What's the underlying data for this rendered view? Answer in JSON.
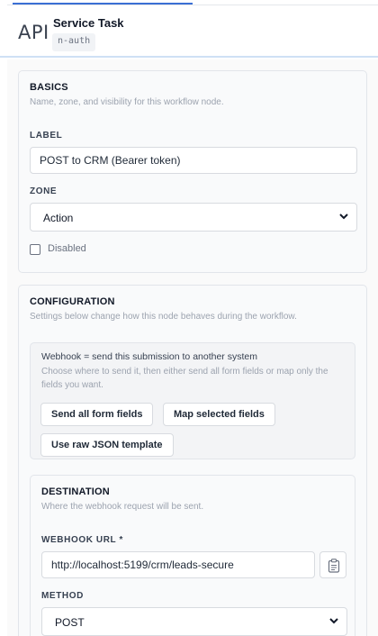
{
  "header": {
    "type_label": "API",
    "title": "Service Task",
    "node_id": "n-auth"
  },
  "basics": {
    "title": "BASICS",
    "description": "Name, zone, and visibility for this workflow node.",
    "label_field": {
      "label": "LABEL",
      "value": "POST to CRM (Bearer token)"
    },
    "zone_field": {
      "label": "ZONE",
      "value": "Action"
    },
    "disabled": {
      "label": "Disabled",
      "checked": false
    }
  },
  "configuration": {
    "title": "CONFIGURATION",
    "description": "Settings below change how this node behaves during the workflow.",
    "webhook": {
      "heading": "Webhook = send this submission to another system",
      "description": "Choose where to send it, then either send all form fields or map only the fields you want.",
      "buttons": {
        "send_all": "Send all form fields",
        "map_selected": "Map selected fields",
        "raw_json": "Use raw JSON template"
      }
    },
    "destination": {
      "title": "DESTINATION",
      "description": "Where the webhook request will be sent.",
      "url_field": {
        "label": "WEBHOOK URL *",
        "value": "http://localhost:5199/crm/leads-secure"
      },
      "method_field": {
        "label": "METHOD",
        "value": "POST"
      }
    }
  },
  "icons": {
    "url_action": "clipboard-icon",
    "select_chevron": "chevron-down-icon"
  }
}
